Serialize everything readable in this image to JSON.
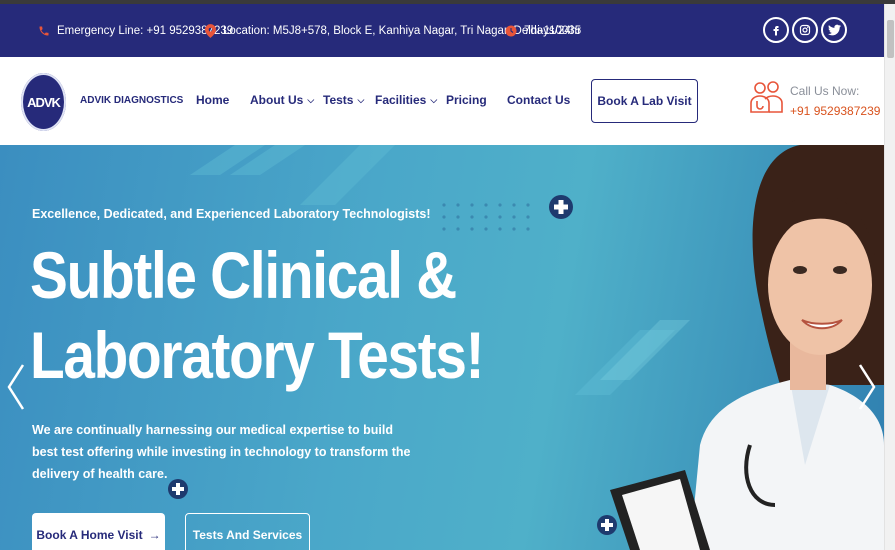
{
  "topbar": {
    "emergency": "Emergency Line: +91 9529387239",
    "location": "Location: M5J8+578, Block E, Kanhiya Nagar, Tri Nagar, Delhi-110035",
    "hours": "7days/24hr"
  },
  "brand": {
    "logo_text": "ADVK",
    "name": "ADVIK DIAGNOSTICS"
  },
  "nav": {
    "home": "Home",
    "about": "About Us",
    "tests": "Tests",
    "facilities": "Facilities",
    "pricing": "Pricing",
    "contact": "Contact Us",
    "book": "Book A Lab Visit"
  },
  "call": {
    "label": "Call Us Now:",
    "number": "+91 9529387239"
  },
  "hero": {
    "tagline": "Excellence, Dedicated, and Experienced Laboratory Technologists!",
    "headline_1": "Subtle Clinical &",
    "headline_2": "Laboratory Tests!",
    "description": "We are continually harnessing our medical expertise to build best test offering while investing in technology to transform the delivery of health care.",
    "btn_home": "Book A Home Visit",
    "btn_tests": "Tests And Services"
  },
  "colors": {
    "primary": "#262a7a",
    "accent": "#d9531e",
    "hero": "#4aa7c9"
  }
}
